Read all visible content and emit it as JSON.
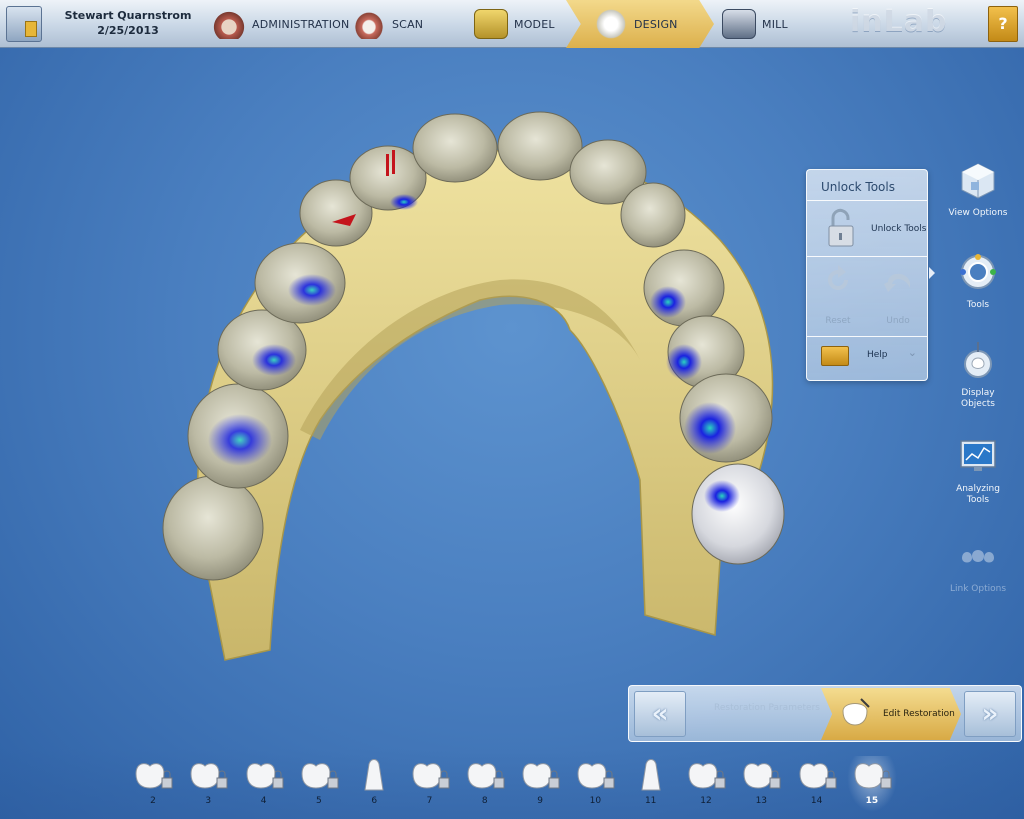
{
  "header": {
    "patient_name": "Stewart Quarnstrom",
    "patient_date": "2/25/2013",
    "steps": [
      {
        "label": "ADMINISTRATION"
      },
      {
        "label": "SCAN"
      },
      {
        "label": "MODEL"
      },
      {
        "label": "DESIGN",
        "active": true
      },
      {
        "label": "MILL"
      }
    ],
    "brand": "inLab"
  },
  "tools_panel": {
    "title": "Unlock Tools",
    "unlock_label": "Unlock Tools",
    "reset_label": "Reset",
    "undo_label": "Undo",
    "help_label": "Help"
  },
  "side_bar": {
    "view_options": "View Options",
    "tools": "Tools",
    "display_objects": "Display Objects",
    "analyzing_tools": "Analyzing Tools",
    "link_options": "Link Options"
  },
  "workflow": {
    "restoration_parameters": "Restoration Parameters",
    "edit_restoration": "Edit Restoration"
  },
  "teeth": {
    "numbers": [
      "2",
      "3",
      "4",
      "5",
      "6",
      "7",
      "8",
      "9",
      "10",
      "11",
      "12",
      "13",
      "14",
      "15"
    ],
    "active": "15"
  },
  "colors": {
    "accent_gold": "#dcb04c",
    "background_blue": "#4a7fc0",
    "model_yellow": "#e9d98f",
    "tooth_grey": "#c8c6b2",
    "contact_blue": "#2430d8"
  }
}
